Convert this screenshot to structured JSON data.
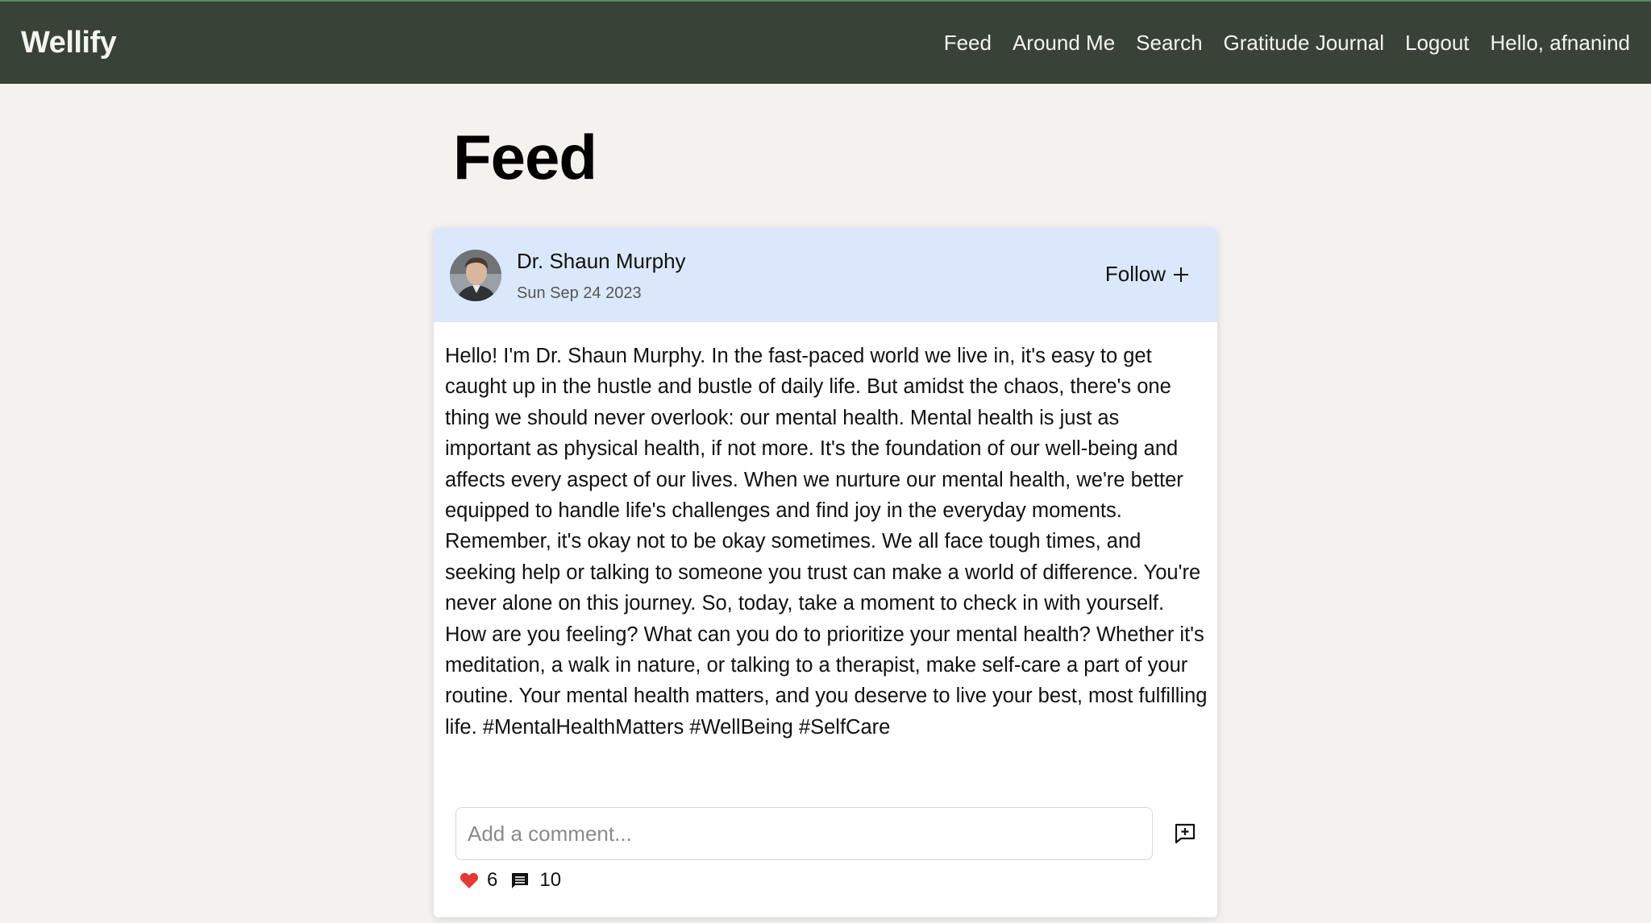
{
  "navbar": {
    "brand": "Wellify",
    "links": [
      "Feed",
      "Around Me",
      "Search",
      "Gratitude Journal",
      "Logout"
    ],
    "greeting": "Hello, afnanind"
  },
  "page": {
    "title": "Feed"
  },
  "post": {
    "author": "Dr. Shaun Murphy",
    "date": "Sun Sep 24 2023",
    "follow_label": "Follow",
    "follow_icon": "plus-icon",
    "body": "Hello! I'm Dr. Shaun Murphy. In the fast-paced world we live in, it's easy to get caught up in the hustle and bustle of daily life. But amidst the chaos, there's one thing we should never overlook: our mental health. Mental health is just as important as physical health, if not more. It's the foundation of our well-being and affects every aspect of our lives. When we nurture our mental health, we're better equipped to handle life's challenges and find joy in the everyday moments. Remember, it's okay not to be okay sometimes. We all face tough times, and seeking help or talking to someone you trust can make a world of difference. You're never alone on this journey. So, today, take a moment to check in with yourself. How are you feeling? What can you do to prioritize your mental health? Whether it's meditation, a walk in nature, or talking to a therapist, make self-care a part of your routine. Your mental health matters, and you deserve to live your best, most fulfilling life. #MentalHealthMatters #WellBeing #SelfCare",
    "comment_placeholder": "Add a comment...",
    "likes": "6",
    "comments": "10"
  },
  "colors": {
    "navbar_bg": "#384236",
    "header_bg": "#dbe8fb",
    "page_bg": "#f3f2ef",
    "heart": "#e53935"
  }
}
